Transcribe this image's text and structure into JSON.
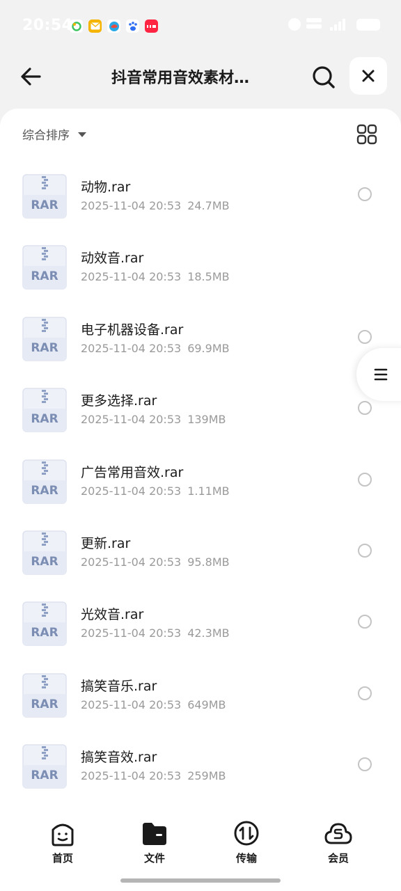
{
  "status_bar": {
    "time": "20:54",
    "notification_icons": [
      "wechat-icon",
      "mail-icon",
      "bird-app-icon",
      "baidu-icon",
      "xiaohongshu-icon"
    ],
    "colors": {
      "wechat": "#3cc35f",
      "mail": "#f5b400",
      "bird": "#e84d3d",
      "baidu": "#2f6ef3",
      "xiaohongshu": "#ff2442"
    }
  },
  "header": {
    "title": "抖音常用音效素材…",
    "back_icon": "arrow-left-icon",
    "search_icon": "search-icon",
    "close_icon": "close-icon"
  },
  "toolbar": {
    "sort_label": "综合排序",
    "view_icon": "grid-view-icon"
  },
  "file_type_label": "RAR",
  "files": [
    {
      "name": "动物.rar",
      "date": "2025-11-04 20:53",
      "size": "24.7MB"
    },
    {
      "name": "动效音.rar",
      "date": "2025-11-04 20:53",
      "size": "18.5MB"
    },
    {
      "name": "电子机器设备.rar",
      "date": "2025-11-04 20:53",
      "size": "69.9MB"
    },
    {
      "name": "更多选择.rar",
      "date": "2025-11-04 20:53",
      "size": "139MB"
    },
    {
      "name": "广告常用音效.rar",
      "date": "2025-11-04 20:53",
      "size": "1.11MB"
    },
    {
      "name": "更新.rar",
      "date": "2025-11-04 20:53",
      "size": "95.8MB"
    },
    {
      "name": "光效音.rar",
      "date": "2025-11-04 20:53",
      "size": "42.3MB"
    },
    {
      "name": "搞笑音乐.rar",
      "date": "2025-11-04 20:53",
      "size": "649MB"
    },
    {
      "name": "搞笑音效.rar",
      "date": "2025-11-04 20:53",
      "size": "259MB"
    }
  ],
  "bottom_nav": [
    {
      "label": "首页",
      "icon": "smile-home-icon"
    },
    {
      "label": "文件",
      "icon": "folder-icon"
    },
    {
      "label": "传输",
      "icon": "transfer-icon"
    },
    {
      "label": "会员",
      "icon": "cloud-member-icon"
    }
  ]
}
